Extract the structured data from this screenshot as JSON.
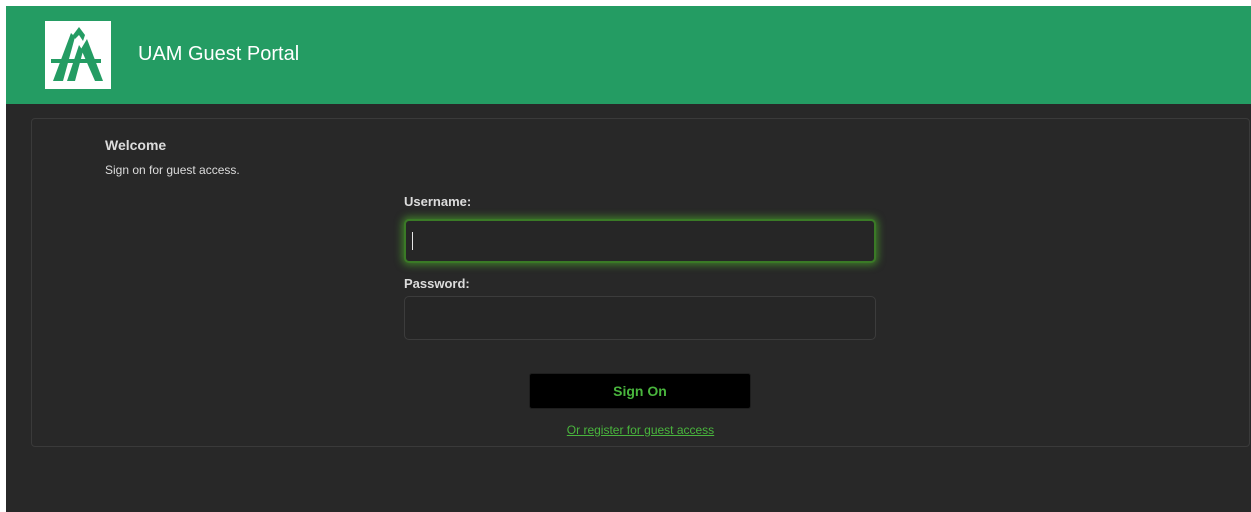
{
  "header": {
    "title": "UAM Guest Portal",
    "logo_icon": "uam-logo-icon",
    "bg_color": "#249c63"
  },
  "welcome": {
    "title": "Welcome",
    "subtitle": "Sign on for guest access."
  },
  "form": {
    "username_label": "Username:",
    "username_value": "",
    "password_label": "Password:",
    "password_value": "",
    "sign_on_label": "Sign On",
    "register_link": "Or register for guest access"
  },
  "colors": {
    "accent": "#49b53d",
    "background": "#282828"
  }
}
